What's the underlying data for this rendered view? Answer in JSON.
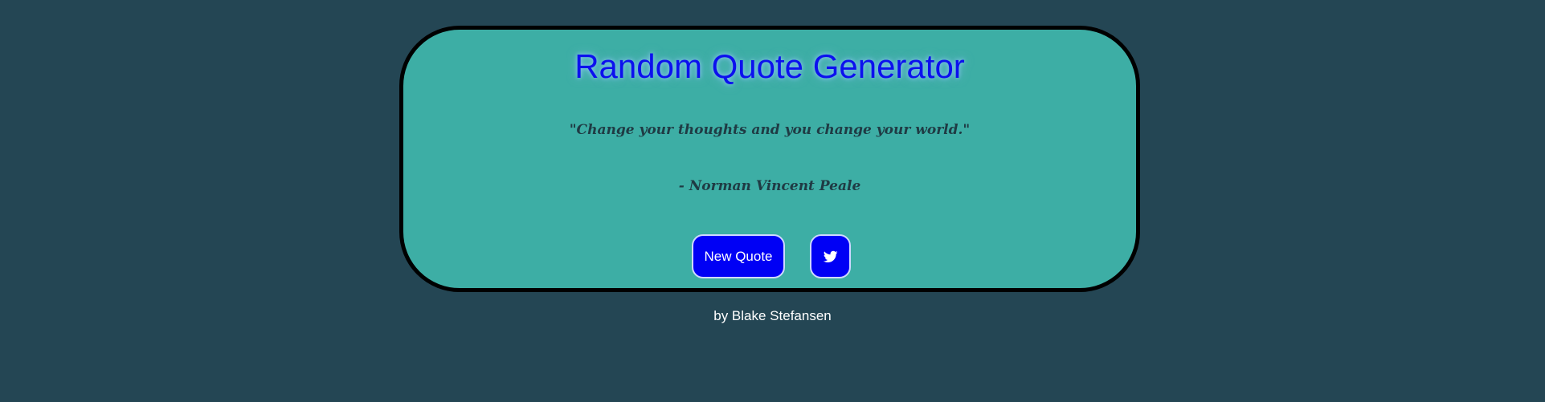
{
  "app": {
    "title": "Random Quote Generator"
  },
  "quote": {
    "text": "\"Change your thoughts and you change your world.\"",
    "author": "- Norman Vincent Peale"
  },
  "actions": {
    "new_quote_label": "New Quote",
    "tweet_icon": "twitter-icon"
  },
  "footer": {
    "credit": "by Blake Stefansen"
  },
  "colors": {
    "page_background": "#244654",
    "card_background": "#3daea5",
    "card_border": "#000000",
    "title_text": "#0c10ee",
    "button_background": "#0000f5",
    "button_text": "#ffffff",
    "quote_text": "#1f3b44",
    "footer_text": "#ffffff"
  }
}
